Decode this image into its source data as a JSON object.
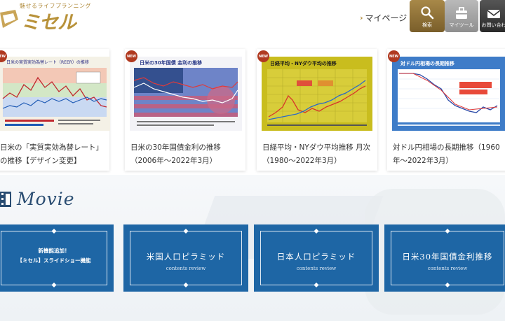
{
  "header": {
    "tagline": "魅せるライフプランニング",
    "logo_text": "ミセル",
    "mypage_label": "マイページ",
    "buttons": {
      "search": "検索",
      "mytool": "マイツール",
      "contact": "お問い合わ"
    }
  },
  "cards": [
    {
      "badge": "NEW",
      "chart_heading": "日米の実質実効為替レート（REER）の推移",
      "title": "日米の「実質実効為替レート」の推移【デザイン変更】"
    },
    {
      "badge": "NEW",
      "chart_heading": "日米の30年国債 金利の推移",
      "title": "日米の30年国債金利の推移（2006年～2022年3月）"
    },
    {
      "badge": "NEW",
      "chart_heading": "日経平均・NYダウ平均の推移",
      "title": "日経平均・NYダウ平均推移 月次（1980～2022年3月）"
    },
    {
      "badge": "NEW",
      "chart_heading": "対ドル円相場の長期推移",
      "title": "対ドル円相場の長期推移（1960年～2022年3月）"
    }
  ],
  "movie": {
    "heading": "Movie",
    "tiles": [
      {
        "line1": "新機能追加！",
        "line2": "【ミセル】スライドショー機能"
      },
      {
        "title": "米国人口ピラミッド",
        "sub": "contents review"
      },
      {
        "title": "日本人口ピラミッド",
        "sub": "contents review"
      },
      {
        "title": "日米30年国債金利推移",
        "sub": "contents review"
      }
    ]
  },
  "colors": {
    "brand_gold": "#b8923a",
    "new_badge": "#b0391f",
    "tile_blue": "#1e66a5",
    "heading_blue": "#2a4d72"
  }
}
